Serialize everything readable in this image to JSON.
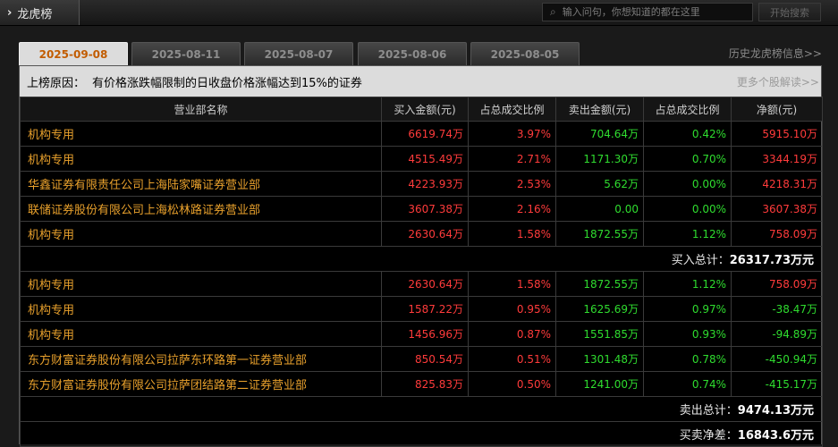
{
  "app": {
    "title": "龙虎榜",
    "search_placeholder": "输入问句，你想知道的都在这里",
    "search_button": "开始搜索"
  },
  "tabs": [
    {
      "label": "2025-09-08",
      "active": true
    },
    {
      "label": "2025-08-11",
      "active": false
    },
    {
      "label": "2025-08-07",
      "active": false
    },
    {
      "label": "2025-08-06",
      "active": false
    },
    {
      "label": "2025-08-05",
      "active": false
    }
  ],
  "history_link": "历史龙虎榜信息>>",
  "reason": {
    "label": "上榜原因：",
    "text": "有价格涨跌幅限制的日收盘价格涨幅达到15%的证券",
    "more_link": "更多个股解读>>"
  },
  "table": {
    "headers": [
      "营业部名称",
      "买入金额(元)",
      "占总成交比例",
      "卖出金额(元)",
      "占总成交比例",
      "净额(元)"
    ],
    "buy_rows": [
      {
        "name": "机构专用",
        "buy": "6619.74万",
        "buy_pct": "3.97%",
        "sell": "704.64万",
        "sell_pct": "0.42%",
        "net": "5915.10万"
      },
      {
        "name": "机构专用",
        "buy": "4515.49万",
        "buy_pct": "2.71%",
        "sell": "1171.30万",
        "sell_pct": "0.70%",
        "net": "3344.19万"
      },
      {
        "name": "华鑫证券有限责任公司上海陆家嘴证券营业部",
        "buy": "4223.93万",
        "buy_pct": "2.53%",
        "sell": "5.62万",
        "sell_pct": "0.00%",
        "net": "4218.31万"
      },
      {
        "name": "联储证券股份有限公司上海松林路证券营业部",
        "buy": "3607.38万",
        "buy_pct": "2.16%",
        "sell": "0.00",
        "sell_pct": "0.00%",
        "net": "3607.38万"
      },
      {
        "name": "机构专用",
        "buy": "2630.64万",
        "buy_pct": "1.58%",
        "sell": "1872.55万",
        "sell_pct": "1.12%",
        "net": "758.09万"
      }
    ],
    "buy_total_label": "买入总计：",
    "buy_total_value": "26317.73万元",
    "sell_rows": [
      {
        "name": "机构专用",
        "buy": "2630.64万",
        "buy_pct": "1.58%",
        "sell": "1872.55万",
        "sell_pct": "1.12%",
        "net": "758.09万"
      },
      {
        "name": "机构专用",
        "buy": "1587.22万",
        "buy_pct": "0.95%",
        "sell": "1625.69万",
        "sell_pct": "0.97%",
        "net": "-38.47万"
      },
      {
        "name": "机构专用",
        "buy": "1456.96万",
        "buy_pct": "0.87%",
        "sell": "1551.85万",
        "sell_pct": "0.93%",
        "net": "-94.89万"
      },
      {
        "name": "东方财富证券股份有限公司拉萨东环路第一证券营业部",
        "buy": "850.54万",
        "buy_pct": "0.51%",
        "sell": "1301.48万",
        "sell_pct": "0.78%",
        "net": "-450.94万"
      },
      {
        "name": "东方财富证券股份有限公司拉萨团结路第二证券营业部",
        "buy": "825.83万",
        "buy_pct": "0.50%",
        "sell": "1241.00万",
        "sell_pct": "0.74%",
        "net": "-415.17万"
      }
    ],
    "sell_total_label": "卖出总计：",
    "sell_total_value": "9474.13万元",
    "net_label": "买卖净差：",
    "net_value": "16843.6万元"
  },
  "colors": {
    "positive": "#ff3b3b",
    "negative": "#2fdc2f",
    "broker_name": "#e9a12c",
    "active_tab_text": "#c25c00"
  }
}
